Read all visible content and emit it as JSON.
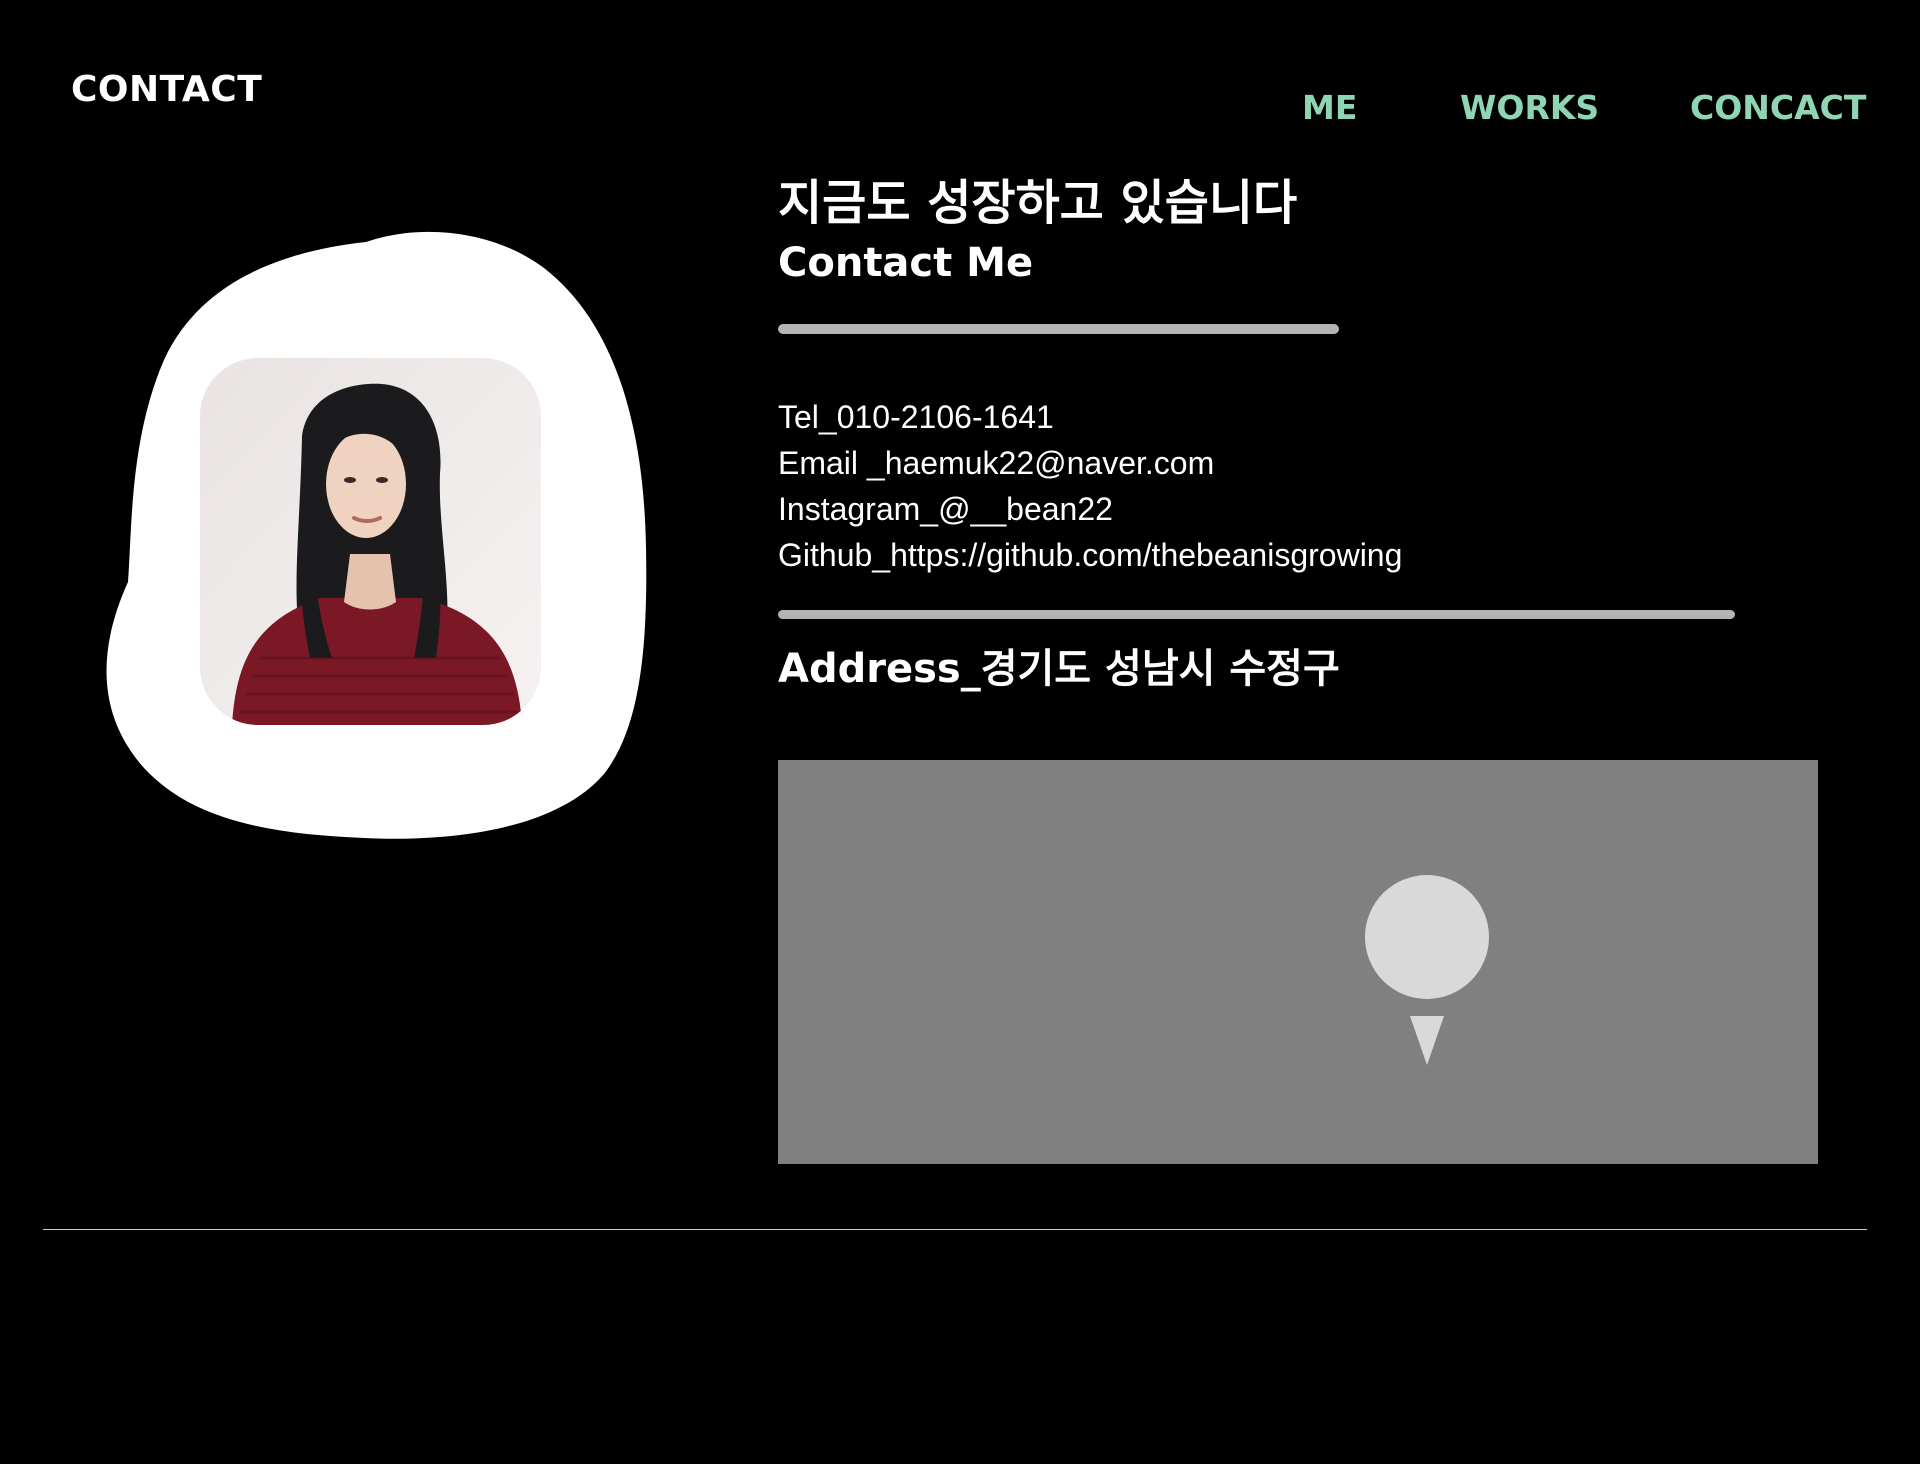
{
  "page": {
    "section_label": "CONTACT"
  },
  "nav": {
    "items": [
      "ME",
      "WORKS",
      "CONCACT"
    ]
  },
  "profile": {
    "photo_alt": "Profile photo"
  },
  "contact": {
    "headline": "지금도 성장하고 있습니다",
    "subheading": "Contact Me",
    "tel": "Tel_010-2106-1641",
    "email": "Email _haemuk22@naver.com",
    "instagram": "Instagram_@__bean22",
    "github": "Github_https://github.com/thebeanisgrowing",
    "address": "Address_경기도 성남시 수정구"
  },
  "map": {
    "icon": "location-pin-icon"
  },
  "colors": {
    "background": "#000000",
    "nav_accent": "#8fd5b4",
    "divider": "#b3b3b3",
    "map_bg": "#808080",
    "pin": "#d9d9d9"
  }
}
